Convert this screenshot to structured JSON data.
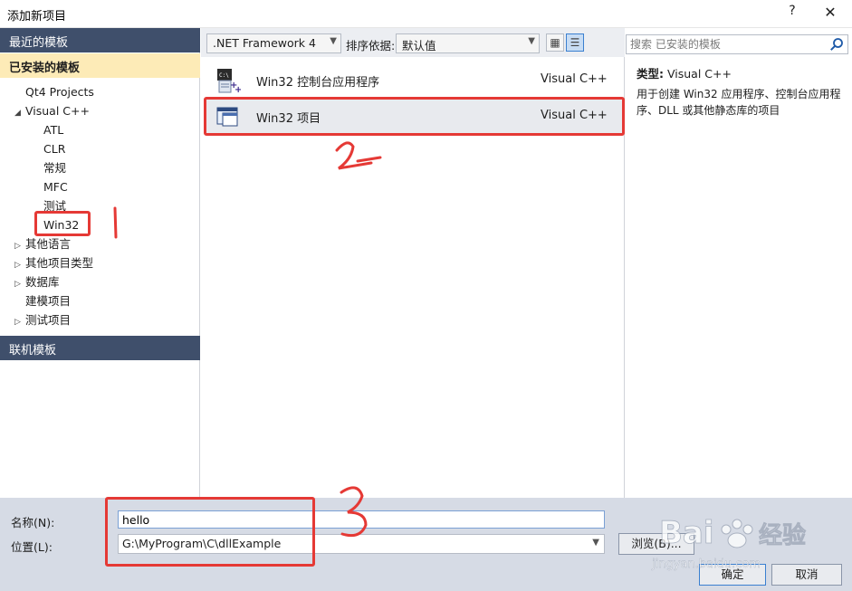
{
  "window": {
    "title": "添加新项目",
    "help": "?",
    "close": "✕"
  },
  "left": {
    "recent_header": "最近的模板",
    "installed_header": "已安装的模板",
    "online_header": "联机模板",
    "tree": [
      {
        "label": "Qt4 Projects",
        "expander": ""
      },
      {
        "label": "Visual C++",
        "expander": "◢"
      },
      {
        "label": "ATL",
        "expander": ""
      },
      {
        "label": "CLR",
        "expander": ""
      },
      {
        "label": "常规",
        "expander": ""
      },
      {
        "label": "MFC",
        "expander": ""
      },
      {
        "label": "测试",
        "expander": ""
      },
      {
        "label": "Win32",
        "expander": ""
      },
      {
        "label": "其他语言",
        "expander": "▷"
      },
      {
        "label": "其他项目类型",
        "expander": "▷"
      },
      {
        "label": "数据库",
        "expander": "▷"
      },
      {
        "label": "建模项目",
        "expander": ""
      },
      {
        "label": "测试项目",
        "expander": "▷"
      }
    ]
  },
  "toolbar": {
    "framework": ".NET Framework 4",
    "sort_label": "排序依据:",
    "sort_value": "默认值"
  },
  "templates": [
    {
      "name": "Win32 控制台应用程序",
      "lang": "Visual C++",
      "icon": "console-app-icon"
    },
    {
      "name": "Win32 项目",
      "lang": "Visual C++",
      "icon": "win32-project-icon"
    }
  ],
  "search": {
    "placeholder": "搜索 已安装的模板"
  },
  "info": {
    "type_label": "类型:",
    "type_value": "Visual C++",
    "description": "用于创建 Win32 应用程序、控制台应用程序、DLL 或其他静态库的项目"
  },
  "form": {
    "name_label": "名称(N):",
    "name_value": "hello",
    "location_label": "位置(L):",
    "location_value": "G:\\MyProgram\\C\\dllExample",
    "browse": "浏览(B)...",
    "ok": "确定",
    "cancel": "取消"
  },
  "watermark": {
    "brand": "Bai",
    "brand2": "经验",
    "site": "jingyan.baidu.com"
  },
  "colors": {
    "header": "#3f4f6b",
    "selected": "#fdebb7",
    "annotation": "#e53935",
    "bottom": "#d6dbe5"
  }
}
